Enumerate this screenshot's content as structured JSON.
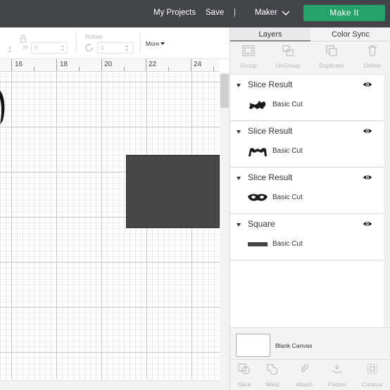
{
  "header": {
    "my_projects": "My Projects",
    "save": "Save",
    "separator": "|",
    "machine": "Maker",
    "make_it": "Make It"
  },
  "edit_bar": {
    "h_label": "H",
    "h_value": "0",
    "rotate_label": "Rotate",
    "rotate_value": "0",
    "more": "More"
  },
  "ruler": {
    "labels": [
      "16",
      "18",
      "20",
      "22",
      "24"
    ]
  },
  "panel": {
    "tabs": [
      "Layers",
      "Color Sync"
    ],
    "tools": [
      "Group",
      "UnGroup",
      "Duplicate",
      "Delete"
    ],
    "layers": [
      {
        "name": "Slice Result",
        "cut": "Basic Cut",
        "thumb": "slice-result-1-thumbnail"
      },
      {
        "name": "Slice Result",
        "cut": "Basic Cut",
        "thumb": "slice-result-2-thumbnail"
      },
      {
        "name": "Slice Result",
        "cut": "Basic Cut",
        "thumb": "slice-result-3-thumbnail"
      },
      {
        "name": "Square",
        "cut": "Basic Cut",
        "thumb": "square-thumbnail"
      }
    ],
    "blank_canvas": "Blank Canvas",
    "bottom_tools": [
      "Slice",
      "Weld",
      "Attach",
      "Flatten",
      "Contour"
    ]
  },
  "colors": {
    "topbar": "#414549",
    "make_it": "#25a36a",
    "square_fill": "#474747"
  }
}
